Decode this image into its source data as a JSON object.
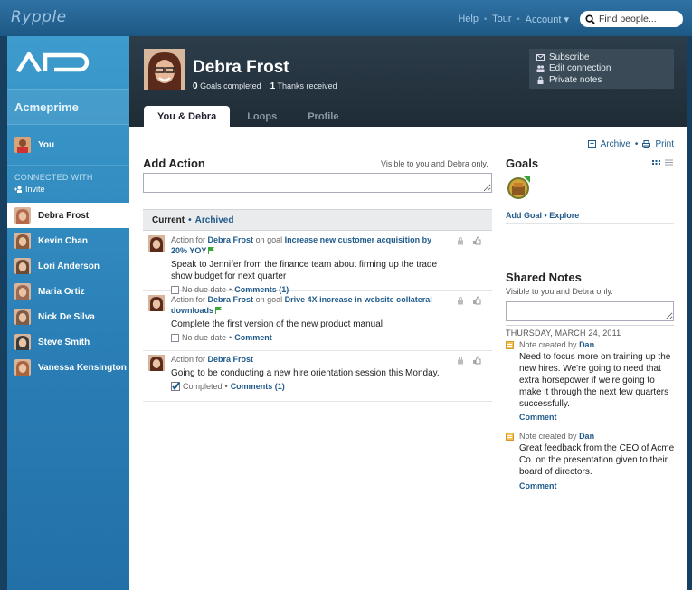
{
  "app": {
    "brand": "Rypple"
  },
  "topnav": {
    "help": "Help",
    "tour": "Tour",
    "account": "Account ▾",
    "search_placeholder": "Find people..."
  },
  "sidebar": {
    "org_name": "Acmeprime",
    "you": "You",
    "connected_with": "CONNECTED WITH",
    "invite": "Invite",
    "people": [
      {
        "name": "Debra Frost",
        "active": true,
        "color": "#b56a4d"
      },
      {
        "name": "Kevin Chan",
        "active": false,
        "color": "#8a5a3a"
      },
      {
        "name": "Lori Anderson",
        "active": false,
        "color": "#6b4a36"
      },
      {
        "name": "Maria Ortiz",
        "active": false,
        "color": "#9a6a52"
      },
      {
        "name": "Nick De Silva",
        "active": false,
        "color": "#7d5d48"
      },
      {
        "name": "Steve Smith",
        "active": false,
        "color": "#3a3a3a"
      },
      {
        "name": "Vanessa Kensington",
        "active": false,
        "color": "#a8653e"
      }
    ]
  },
  "profile": {
    "name": "Debra Frost",
    "goals_completed_count": "0",
    "goals_completed_label": "Goals completed",
    "thanks_count": "1",
    "thanks_label": "Thanks received"
  },
  "profile_actions": {
    "subscribe": "Subscribe",
    "edit_connection": "Edit connection",
    "private_notes": "Private notes"
  },
  "tabs": [
    "You & Debra",
    "Loops",
    "Profile"
  ],
  "toolbar": {
    "archive": "Archive",
    "print": "Print"
  },
  "add_action": {
    "title": "Add Action",
    "visibility": "Visible to you and Debra only."
  },
  "feed": {
    "current": "Current",
    "archived": "Archived",
    "items": [
      {
        "prefix": "Action for",
        "person": "Debra Frost",
        "goal_prefix": "on goal",
        "goal": "Increase new customer acquisition by 20% YOY",
        "text": "Speak to Jennifer from the finance team about firming up the trade show budget for next quarter",
        "status": "No due date",
        "comments": "Comments (1)"
      },
      {
        "prefix": "Action for",
        "person": "Debra Frost",
        "goal_prefix": "on goal",
        "goal": "Drive 4X increase in website collateral downloads",
        "text": "Complete the first version of the new product manual",
        "status": "No due date",
        "comments": "Comment"
      },
      {
        "prefix": "Action for",
        "person": "Debra Frost",
        "goal_prefix": "",
        "goal": "",
        "text": "Going to be conducting a new hire orientation session this Monday.",
        "status": "Completed",
        "comments": "Comments (1)"
      }
    ]
  },
  "goals": {
    "title": "Goals",
    "add_goal": "Add Goal",
    "explore": "Explore"
  },
  "shared_notes": {
    "title": "Shared Notes",
    "visibility": "Visible to you and Debra only.",
    "date": "THURSDAY, MARCH 24, 2011",
    "notes": [
      {
        "meta_prefix": "Note created by",
        "author": "Dan",
        "text": "Need to focus more on training up the new hires. We're going to need that extra horsepower if we're going to make it through the next few quarters successfully.",
        "comment": "Comment"
      },
      {
        "meta_prefix": "Note created by",
        "author": "Dan",
        "text": "Great feedback from the CEO of Acme Co. on the presentation given to their board of directors.",
        "comment": "Comment"
      }
    ]
  },
  "colors": {
    "link": "#1f5a8a",
    "sidebar": "#2a7fb6",
    "header": "#26343f",
    "flag": "#3aa63a",
    "note_icon": "#e8a93a"
  }
}
